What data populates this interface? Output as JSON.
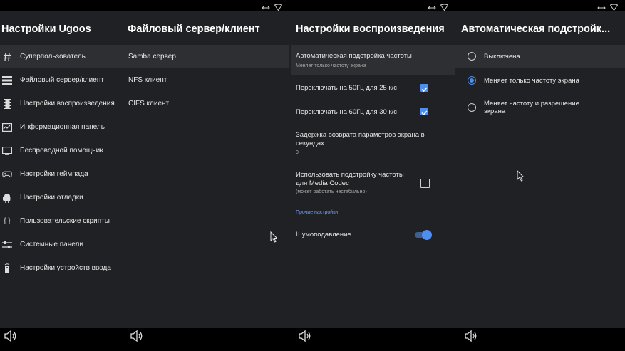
{
  "colors": {
    "accent": "#4d8ef0",
    "panel": "#202124",
    "selected": "#2e2f32"
  },
  "status_icons": [
    "swap-arrows-icon",
    "wifi-icon"
  ],
  "nav_icon": "volume-icon",
  "col1": {
    "title": "Настройки Ugoos",
    "items": [
      {
        "label": "Суперпользователь",
        "icon": "hash-icon"
      },
      {
        "label": "Файловый сервер/клиент",
        "icon": "server-icon"
      },
      {
        "label": "Настройки воспроизведения",
        "icon": "film-icon"
      },
      {
        "label": "Информационная панель",
        "icon": "chart-icon"
      },
      {
        "label": "Беспроводной помощник",
        "icon": "cast-icon"
      },
      {
        "label": "Настройки геймпада",
        "icon": "gamepad-icon"
      },
      {
        "label": "Настройки отладки",
        "icon": "android-icon"
      },
      {
        "label": "Пользовательские скрипты",
        "icon": "braces-icon"
      },
      {
        "label": "Системные панели",
        "icon": "sliders-icon"
      },
      {
        "label": "Настройки устройств ввода",
        "icon": "remote-icon"
      }
    ],
    "braces": "{ }"
  },
  "col2": {
    "title": "Файловый сервер/клиент",
    "items": [
      "Samba сервер",
      "NFS клиент",
      "CIFS клиент"
    ]
  },
  "col3": {
    "title": "Настройки воспроизведения",
    "auto_rate": {
      "label": "Автоматическая подстройка частоты",
      "summary": "Меняет только частоту экрана"
    },
    "switch50": {
      "label": "Переключать на 50Гц для 25 к/с",
      "checked": true
    },
    "switch60": {
      "label": "Переключать на 60Гц для 30 к/с",
      "checked": true
    },
    "delay": {
      "label_line1": "Задержка возврата параметров экрана в",
      "label_line2": "секундах",
      "value": "0"
    },
    "media_codec": {
      "label_line1": "Использовать подстройку частоты",
      "label_line2": "для Media Codec",
      "note": "(может работать нестабильно)",
      "checked": false
    },
    "other_header": "Прочие настройки",
    "noise": {
      "label": "Шумоподавление",
      "on": true
    }
  },
  "col4": {
    "title": "Автоматическая подстройк...",
    "options": [
      {
        "label_line1": "Выключена",
        "label_line2": "",
        "selected": false
      },
      {
        "label_line1": "Меняет только частоту экрана",
        "label_line2": "",
        "selected": true
      },
      {
        "label_line1": "Меняет частоту и разрешение",
        "label_line2": "экрана",
        "selected": false
      }
    ]
  }
}
